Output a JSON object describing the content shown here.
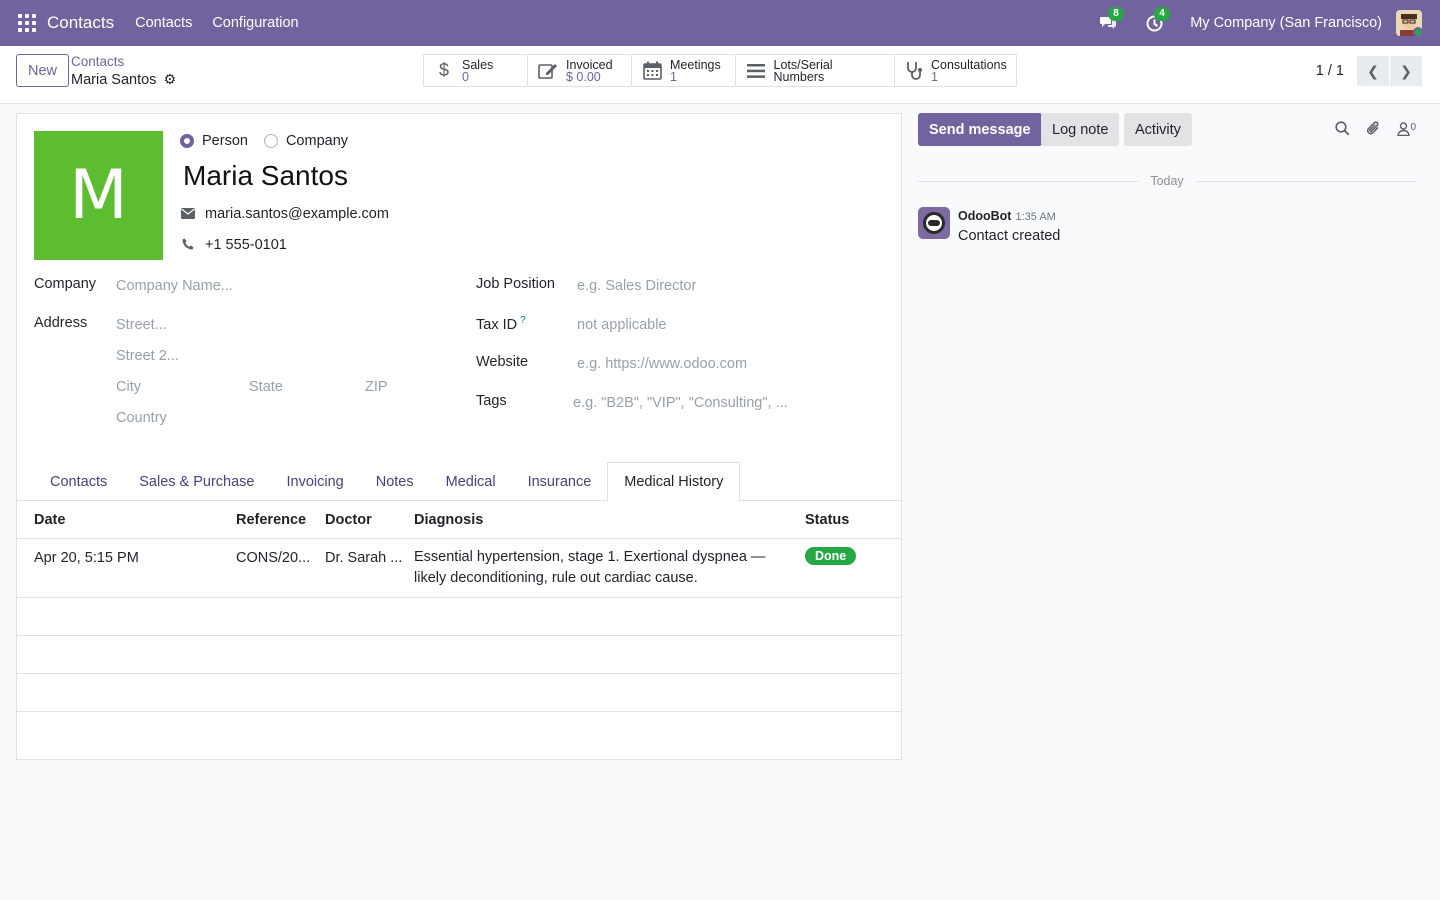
{
  "navbar": {
    "brand": "Contacts",
    "menu": [
      "Contacts",
      "Configuration"
    ],
    "messages_count": "8",
    "activities_count": "4",
    "company": "My Company (San Francisco)"
  },
  "control_panel": {
    "new_label": "New",
    "breadcrumb": "Contacts",
    "record_name": "Maria Santos",
    "smart_buttons": [
      {
        "label": "Sales",
        "value": "0",
        "icon": "dollar-icon"
      },
      {
        "label": "Invoiced",
        "value": "$ 0.00",
        "icon": "pencil-square-icon"
      },
      {
        "label": "Meetings",
        "value": "1",
        "icon": "calendar-icon"
      },
      {
        "label": "Lots/Serial Numbers",
        "value": "",
        "icon": "bars-icon"
      },
      {
        "label": "Consultations",
        "value": "1",
        "icon": "stethoscope-icon"
      }
    ],
    "pager": "1 / 1"
  },
  "form": {
    "avatar_letter": "M",
    "type_person": "Person",
    "type_company": "Company",
    "name": "Maria Santos",
    "email": "maria.santos@example.com",
    "phone": "+1 555-0101",
    "labels": {
      "company": "Company",
      "address": "Address",
      "job_position": "Job Position",
      "tax_id": "Tax ID",
      "website": "Website",
      "tags": "Tags"
    },
    "placeholders": {
      "company": "Company Name...",
      "street": "Street...",
      "street2": "Street 2...",
      "city": "City",
      "state": "State",
      "zip": "ZIP",
      "country": "Country",
      "job_position": "e.g. Sales Director",
      "tax_id": "not applicable",
      "website": "e.g. https://www.odoo.com",
      "tags": "e.g. \"B2B\", \"VIP\", \"Consulting\", ..."
    },
    "tabs": [
      "Contacts",
      "Sales & Purchase",
      "Invoicing",
      "Notes",
      "Medical",
      "Insurance",
      "Medical History"
    ],
    "active_tab": "Medical History"
  },
  "history": {
    "columns": [
      "Date",
      "Reference",
      "Doctor",
      "Diagnosis",
      "Status"
    ],
    "rows": [
      {
        "date": "Apr 20, 5:15 PM",
        "reference": "CONS/20...",
        "doctor": "Dr. Sarah ...",
        "diagnosis": "Essential hypertension, stage 1. Exertional dyspnea — likely deconditioning, rule out cardiac cause.",
        "status": "Done"
      }
    ]
  },
  "chatter": {
    "send_message": "Send message",
    "log_note": "Log note",
    "activity": "Activity",
    "followers_count": "0",
    "day": "Today",
    "messages": [
      {
        "author": "OdooBot",
        "time": "1:35 AM",
        "body": "Contact created"
      }
    ]
  },
  "colors": {
    "brand": "#71639e",
    "avatar_bg": "#5cbd30",
    "done": "#28a745"
  }
}
